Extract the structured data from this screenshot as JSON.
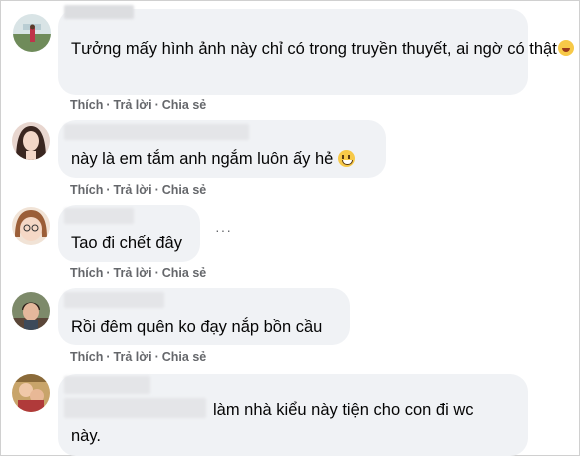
{
  "comments": [
    {
      "text": "Tưởng mấy hình ảnh này chỉ có trong truyền thuyết, ai ngờ có thật",
      "emoji": "rolling-laughing-emoji",
      "actions": {
        "like": "Thích",
        "reply": "Trả lời",
        "share": "Chia sẻ"
      }
    },
    {
      "text": "này là em tắm anh ngắm luôn ấy hẻ",
      "emoji": "smiling-emoji",
      "actions": {
        "like": "Thích",
        "reply": "Trả lời",
        "share": "Chia sẻ"
      }
    },
    {
      "text": "Tao đi chết đây",
      "more": "···",
      "actions": {
        "like": "Thích",
        "reply": "Trả lời",
        "share": "Chia sẻ"
      }
    },
    {
      "text": "Rồi đêm quên ko đạy nắp bồn cầu",
      "actions": {
        "like": "Thích",
        "reply": "Trả lời",
        "share": "Chia sẻ"
      }
    },
    {
      "text_line1": "làm nhà kiểu này tiện cho con đi wc",
      "text_line2": "này."
    }
  ],
  "separator": "·",
  "colors": {
    "bubble": "#f0f2f5",
    "action_text": "#65676b",
    "comment_text": "#050505"
  }
}
